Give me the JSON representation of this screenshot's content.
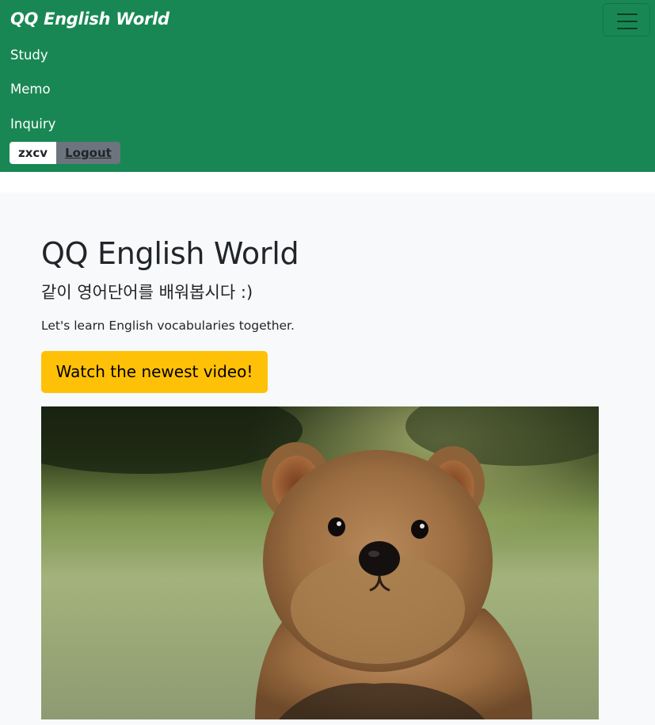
{
  "navbar": {
    "brand": "QQ English World",
    "toggler_icon": "hamburger-menu-icon",
    "links": [
      "Study",
      "Memo",
      "Inquiry"
    ],
    "username": "zxcv",
    "logout_label": "Logout"
  },
  "hero": {
    "title": "QQ English World",
    "subtitle": "같이 영어단어를 배워봅시다 :)",
    "lead": "Let's learn English vocabularies together.",
    "cta_label": "Watch the newest video!"
  },
  "colors": {
    "navbar": "#198754",
    "hero_background": "#f8f9fa",
    "cta": "#ffc107",
    "logout": "#6c757d"
  }
}
